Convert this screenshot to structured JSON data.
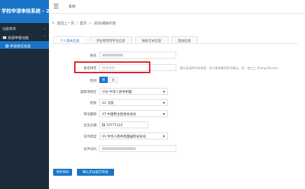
{
  "sidebar": {
    "brand": "学校申请审核系统 - 2",
    "section_label": "功能菜单",
    "group_label": "资源申报功能",
    "active_item": "申请单位信息"
  },
  "topbar": {
    "menu_icon": "hamburger-icon",
    "tab_label": "系统"
  },
  "breadcrumb": {
    "back": "返回上一页",
    "home": "首页",
    "current": "添加/编辑内容"
  },
  "tabs": [
    {
      "label": "个人基本信息",
      "active": true
    },
    {
      "label": "学业和学历学位信息",
      "active": false
    },
    {
      "label": "联系方式信息",
      "active": false
    },
    {
      "label": "其他信息",
      "active": false
    }
  ],
  "form": {
    "name_label": "姓名",
    "pinyin_label": "姓名拼音",
    "pinyin_placeholder": "姓名拼音",
    "pinyin_hint": "请以英语拼写名拼音，用于相关事项签字确认，如：张三三 Zheng Sensan",
    "gender_label": "性别",
    "gender_male": "男",
    "gender_female": "女",
    "country_label": "国家或地区",
    "country_value": "156 中华人民共和国",
    "ethnicity_label": "民族",
    "ethnicity_value": "01 汉族",
    "politics_label": "政治面貌",
    "politics_value": "07 中国民主促进会会员",
    "birth_label": "出生日期",
    "birth_value": "19771122",
    "idtype_label": "证件类型",
    "idtype_value": "01 中华人民共和国居民身份证",
    "idnum_label": "证件号码"
  },
  "actions": {
    "save": "保存资料",
    "confirm": "确认无误提交审核"
  }
}
